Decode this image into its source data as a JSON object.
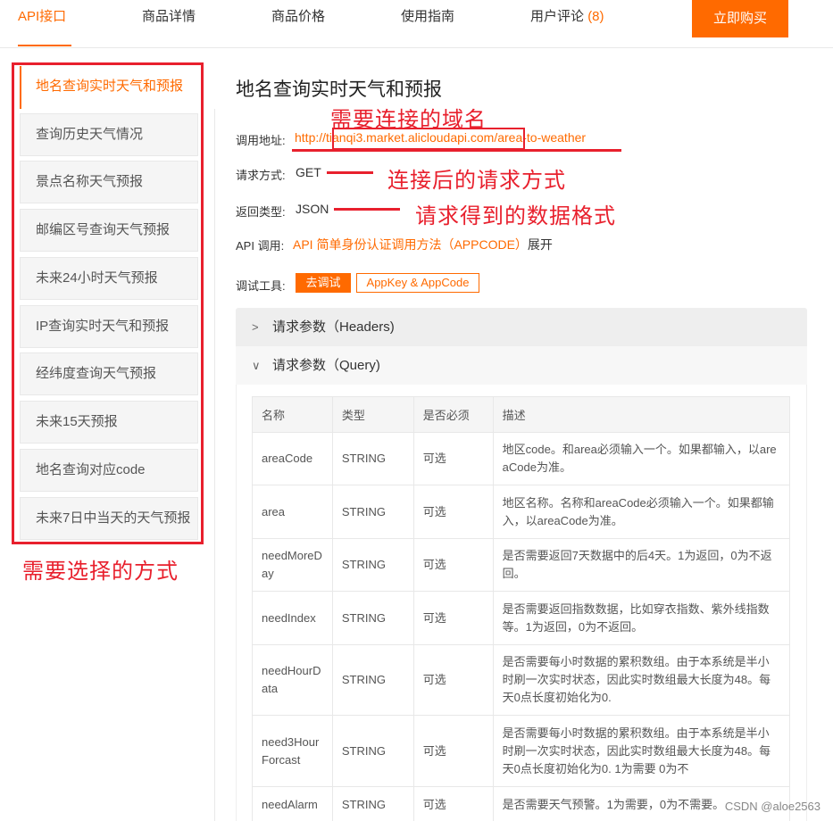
{
  "topnav": {
    "tabs": [
      {
        "label": "API接口",
        "active": true
      },
      {
        "label": "商品详情",
        "active": false
      },
      {
        "label": "商品价格",
        "active": false
      },
      {
        "label": "使用指南",
        "active": false
      },
      {
        "label": "用户评论",
        "active": false,
        "count": "(8)"
      }
    ],
    "buy_label": "立即购买"
  },
  "sidebar": {
    "items": [
      {
        "label": "地名查询实时天气和预报",
        "active": true
      },
      {
        "label": "查询历史天气情况"
      },
      {
        "label": "景点名称天气预报"
      },
      {
        "label": "邮编区号查询天气预报"
      },
      {
        "label": "未来24小时天气预报"
      },
      {
        "label": "IP查询实时天气和预报"
      },
      {
        "label": "经纬度查询天气预报"
      },
      {
        "label": "未来15天预报"
      },
      {
        "label": "地名查询对应code"
      },
      {
        "label": "未来7日中当天的天气预报"
      }
    ]
  },
  "annotations": {
    "domain_note": "需要连接的域名",
    "method_note": "连接后的请求方式",
    "format_note": "请求得到的数据格式",
    "select_note": "需要选择的方式"
  },
  "main": {
    "title": "地名查询实时天气和预报",
    "address_label": "调用地址:",
    "address_url": "http://tianqi3.market.alicloudapi.com/area-to-weather",
    "method_label": "请求方式:",
    "method_value": "GET",
    "return_label": "返回类型:",
    "return_value": "JSON",
    "api_call_label": "API 调用:",
    "api_call_link": "API 简单身份认证调用方法（APPCODE）",
    "api_call_expand": "展开",
    "debug_label": "调试工具:",
    "debug_button": "去调试",
    "appkey_button": "AppKey & AppCode",
    "headers_panel": "请求参数（Headers)",
    "query_panel": "请求参数（Query)"
  },
  "params_table": {
    "headers": [
      "名称",
      "类型",
      "是否必须",
      "描述"
    ],
    "rows": [
      {
        "name": "areaCode",
        "type": "STRING",
        "required": "可选",
        "desc": "地区code。和area必须输入一个。如果都输入，以areaCode为准。"
      },
      {
        "name": "area",
        "type": "STRING",
        "required": "可选",
        "desc": "地区名称。名称和areaCode必须输入一个。如果都输入，以areaCode为准。"
      },
      {
        "name": "needMoreDay",
        "type": "STRING",
        "required": "可选",
        "desc": "是否需要返回7天数据中的后4天。1为返回，0为不返回。"
      },
      {
        "name": "needIndex",
        "type": "STRING",
        "required": "可选",
        "desc": "是否需要返回指数数据，比如穿衣指数、紫外线指数等。1为返回，0为不返回。"
      },
      {
        "name": "needHourData",
        "type": "STRING",
        "required": "可选",
        "desc": "是否需要每小时数据的累积数组。由于本系统是半小时刷一次实时状态，因此实时数组最大长度为48。每天0点长度初始化为0."
      },
      {
        "name": "need3HourForcast",
        "type": "STRING",
        "required": "可选",
        "desc": "是否需要每小时数据的累积数组。由于本系统是半小时刷一次实时状态，因此实时数组最大长度为48。每天0点长度初始化为0. 1为需要 0为不"
      },
      {
        "name": "needAlarm",
        "type": "STRING",
        "required": "可选",
        "desc": "是否需要天气预警。1为需要，0为不需要。"
      }
    ]
  },
  "watermark": "CSDN @aloe2563"
}
